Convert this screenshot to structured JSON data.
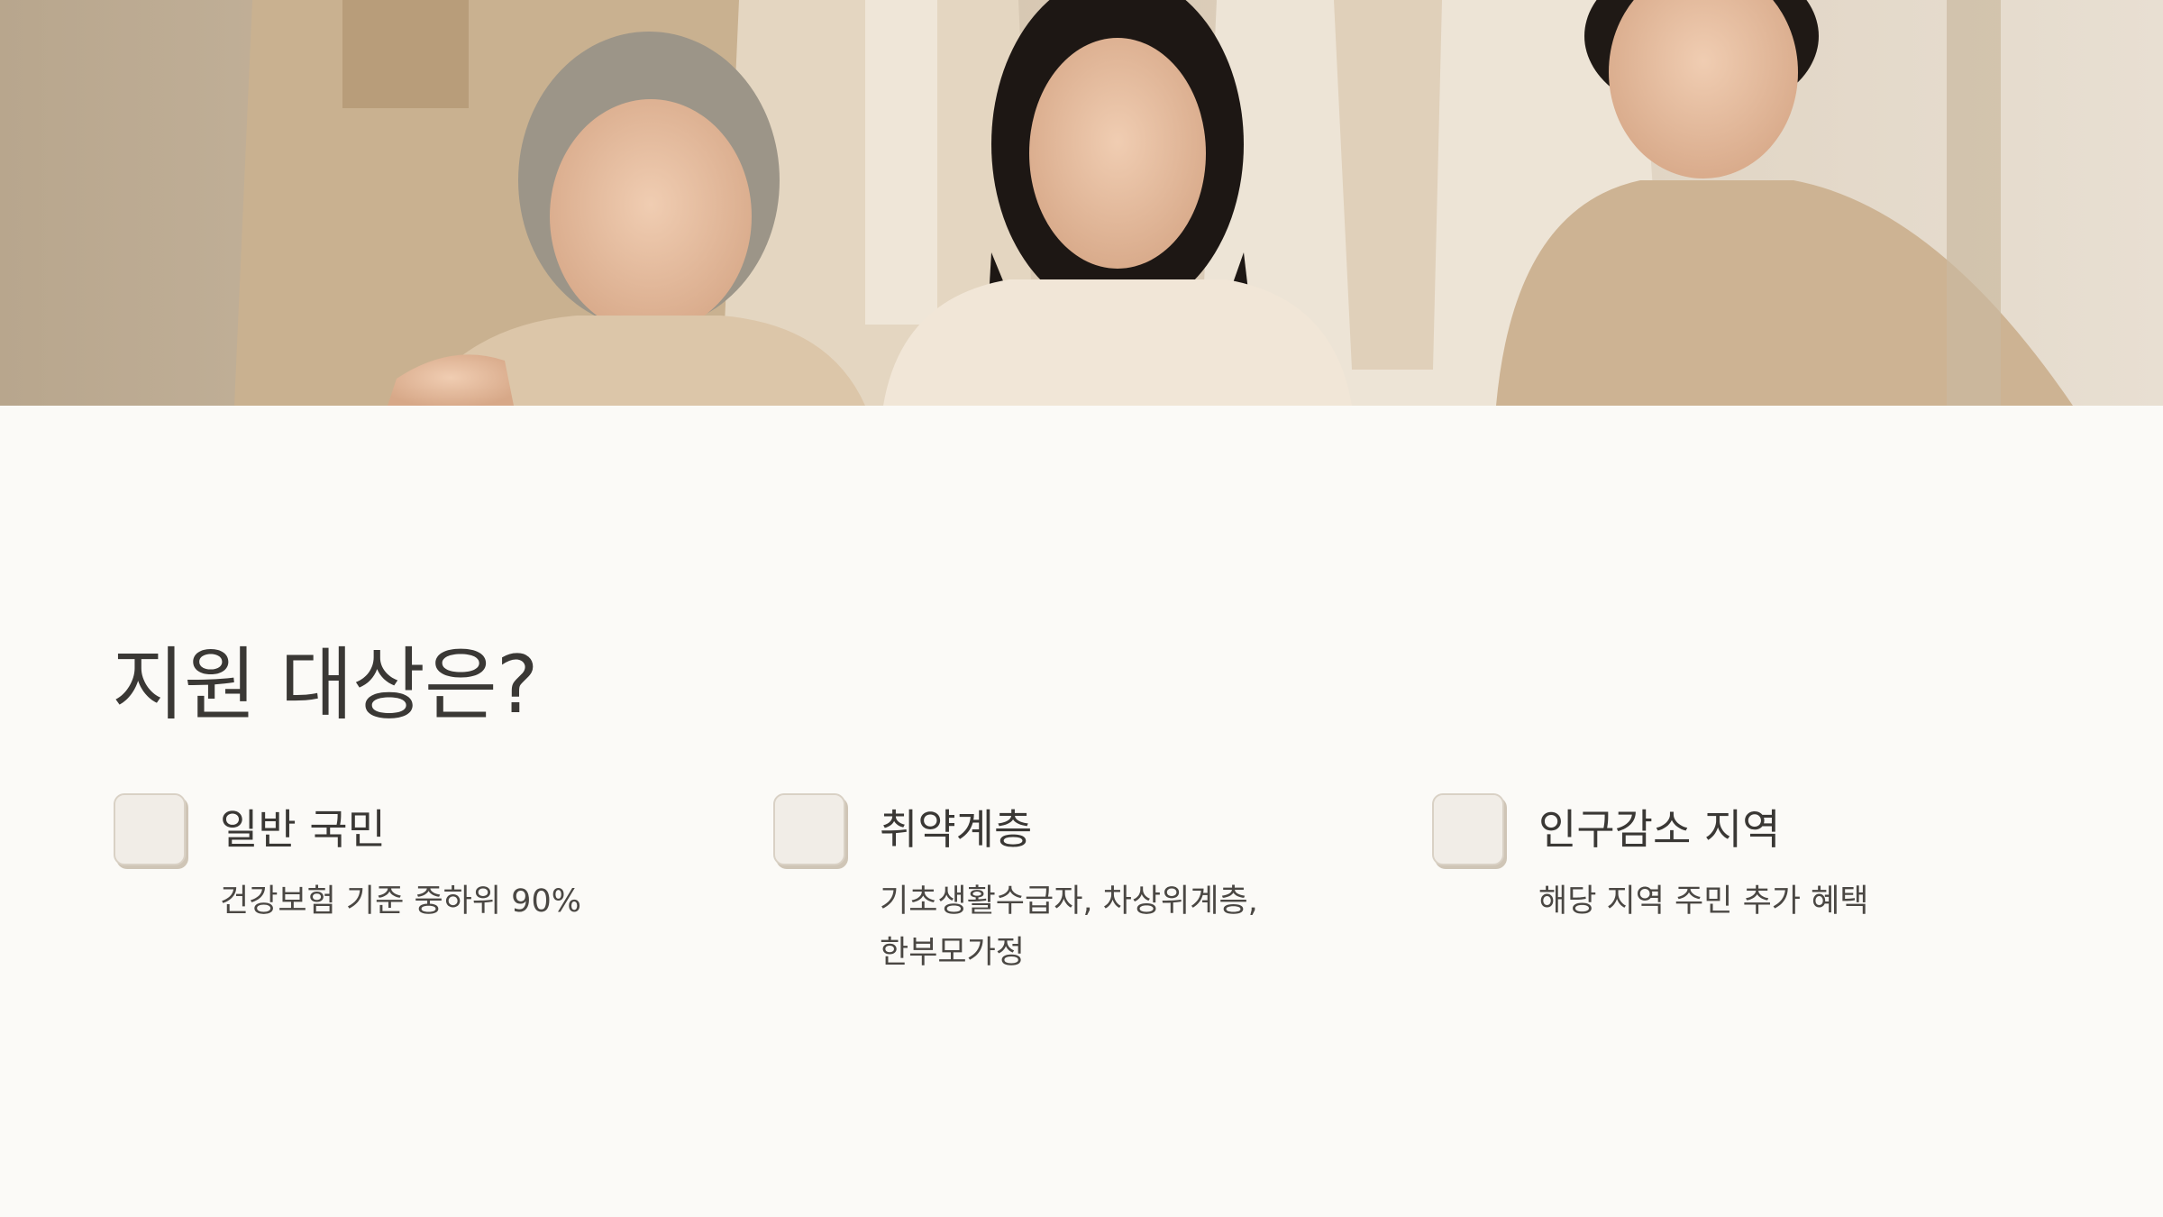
{
  "hero": {
    "image": "family-portrait-photo"
  },
  "section": {
    "title": "지원 대상은?"
  },
  "cards": [
    {
      "label": "일반 국민",
      "desc": "건강보험 기준 중하위 90%",
      "icon": "checkbox-icon"
    },
    {
      "label": "취약계층",
      "desc": "기초생활수급자, 차상위계층, 한부모가정",
      "icon": "checkbox-icon"
    },
    {
      "label": "인구감소 지역",
      "desc": "해당 지역 주민 추가 혜택",
      "icon": "checkbox-icon"
    }
  ],
  "colors": {
    "background": "#fbfaf7",
    "text": "#3a3835",
    "box": "#f1ede7",
    "photo_tone": "#d8c8b1"
  }
}
